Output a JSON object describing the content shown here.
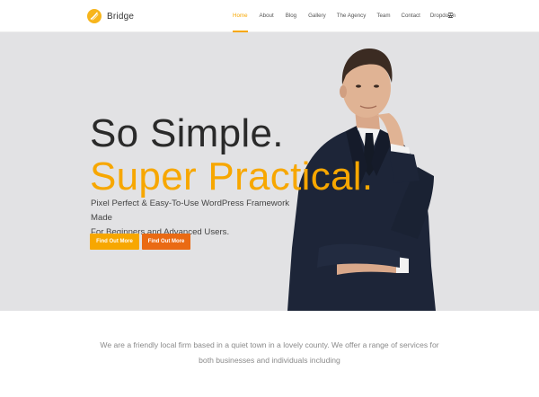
{
  "header": {
    "logo_text": "Bridge",
    "nav": [
      {
        "label": "Home",
        "active": true
      },
      {
        "label": "About"
      },
      {
        "label": "Blog"
      },
      {
        "label": "Gallery"
      },
      {
        "label": "The Agency"
      },
      {
        "label": "Team"
      },
      {
        "label": "Contact"
      },
      {
        "label": "Dropdown"
      }
    ],
    "menu_icon": "hamburger-icon"
  },
  "hero": {
    "title_line1": "So Simple.",
    "title_line2": "Super Practical.",
    "subtitle_line1": "Pixel Perfect & Easy-To-Use WordPress Framework Made",
    "subtitle_line2": "For Beginners and Advanced Users.",
    "buttons": [
      {
        "label": "Find Out More"
      },
      {
        "label": "Find Out More"
      }
    ]
  },
  "intro": {
    "line1": "We are a friendly local firm based in a quiet town in a lovely county. We offer a range of services for",
    "line2": "both businesses and individuals including"
  },
  "colors": {
    "accent": "#f7a700",
    "accent_dark": "#ea6a13",
    "hero_bg": "#e2e2e4",
    "text_dark": "#2a2a2a"
  }
}
